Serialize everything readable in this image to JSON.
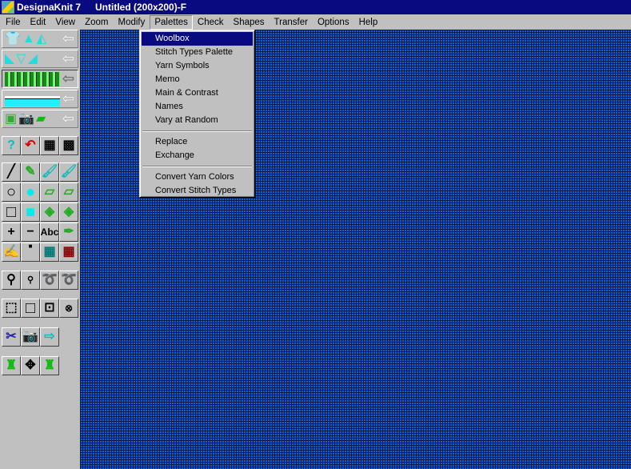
{
  "window": {
    "app_title": "DesignaKnit 7",
    "doc_title": "Untitled (200x200)-F"
  },
  "menubar": [
    "File",
    "Edit",
    "View",
    "Zoom",
    "Modify",
    "Palettes",
    "Check",
    "Shapes",
    "Transfer",
    "Options",
    "Help"
  ],
  "palettes_menu": {
    "group1": [
      "Woolbox",
      "Stitch Types Palette",
      "Yarn Symbols",
      "Memo",
      "Main & Contrast",
      "Names",
      "Vary at Random"
    ],
    "group2": [
      "Replace",
      "Exchange"
    ],
    "group3": [
      "Convert Yarn Colors",
      "Convert Stitch Types"
    ],
    "selected": "Woolbox"
  },
  "toolbar": {
    "text_tool_label": "Abc",
    "help_label": "?"
  },
  "colors": {
    "canvas": "#0c5fd6",
    "grid": "#021a4a",
    "menu_highlight": "#0a0a80"
  }
}
